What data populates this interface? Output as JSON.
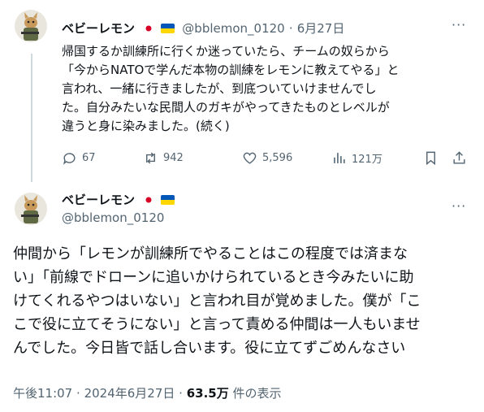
{
  "reply_tweet": {
    "author_name": "ベビーレモン",
    "handle": "@bblemon_0120",
    "separator": "·",
    "date": "6月27日",
    "text": "帰国するか訓練所に行くか迷っていたら、チームの奴らから\n「今からNATOで学んだ本物の訓練をレモンに教えてやる」と\n言われ、一緒に行きましたが、到底ついていけませんでし\nた。自分みたいな民間人のガキがやってきたものとレベルが\n違うと身に染みました。(続く)",
    "actions": {
      "replies": "67",
      "reposts": "942",
      "likes": "5,596",
      "views": "121万"
    }
  },
  "main_tweet": {
    "author_name": "ベビーレモン",
    "handle": "@bblemon_0120",
    "text": "仲間から「レモンが訓練所でやることはこの程度では済まな\nい」「前線でドローンに追いかけられているとき今みたいに助\nけてくれるやつはいない」と言われ目が覚めました。僕が「こ\nこで役に立てそうにない」と言って責める仲間は一人もいませ\nんでした。今日皆で話し合います。役に立てずごめんなさい",
    "time": "午後11:07",
    "separator": "·",
    "date": "2024年6月27日",
    "separator2": "·",
    "view_count": "63.5万",
    "view_label": "件の表示"
  },
  "icons": [
    "more-icon",
    "reply-icon",
    "repost-icon",
    "like-icon",
    "views-icon",
    "bookmark-icon",
    "share-icon"
  ],
  "colors": {
    "text": "#0f1419",
    "muted": "#536471",
    "line": "#cfd9de"
  }
}
